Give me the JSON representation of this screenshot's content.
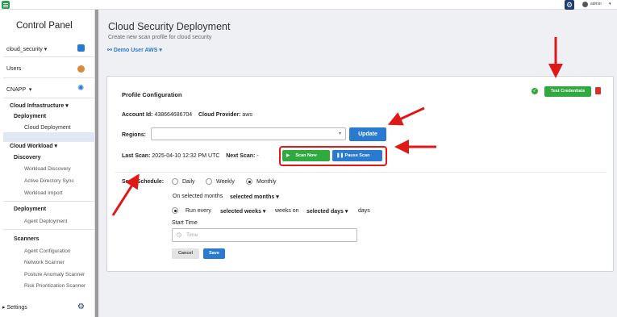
{
  "sidebar": {
    "title": "Control Panel",
    "tenant": "cloud_security",
    "users": "Users",
    "cnapp": "CNAPP",
    "cloud_infra": "Cloud Infrastructure",
    "deployment1": "Deployment",
    "cloud_deployment": "Cloud Deployment",
    "cloud_workload": "Cloud Workload",
    "discovery": "Discovery",
    "workload_discovery": "Workload Discovery",
    "ad_sync": "Active Directory Sync",
    "workload_import": "Workload Import",
    "deployment2": "Deployment",
    "agent_deployment": "Agent Deployment",
    "scanners": "Scanners",
    "agent_config": "Agent Configuration",
    "network_scanner": "Network Scanner",
    "posture_scanner": "Posture Anomaly Scanner",
    "risk_scanner": "Risk Prioritization Scanner",
    "settings": "Settings"
  },
  "header": {
    "title": "Cloud Security Deployment",
    "subtitle": "Create new scan profile for cloud security",
    "account_select": "Demo User AWS",
    "user_name": "admin"
  },
  "profile": {
    "section_title": "Profile Configuration",
    "test_credentials": "Test Credentials",
    "account_id_label": "Account Id:",
    "account_id": "438664686704",
    "provider_label": "Cloud Provider:",
    "provider": "aws",
    "regions_label": "Regions:",
    "regions_value": "",
    "update": "Update",
    "last_scan_label": "Last Scan:",
    "last_scan": "2025-04-10 12:32 PM UTC",
    "next_scan_label": "Next Scan:",
    "next_scan": "-",
    "scan_now": "Scan Now",
    "pause_scan": "Pause Scan"
  },
  "schedule": {
    "label": "Scan Schedule:",
    "daily": "Daily",
    "weekly": "Weekly",
    "monthly": "Monthly",
    "on_selected_months": "On selected months",
    "selected_months": "selected months",
    "run_every": "Run every",
    "selected_weeks": "selected weeks",
    "weeks_on": "weeks on",
    "selected_days": "selected days",
    "days": "days",
    "start_time_label": "Start Time",
    "time_placeholder": "Time",
    "cancel": "Cancel",
    "save": "Save"
  },
  "colors": {
    "green": "#2faa3f",
    "blue": "#2a7bcf",
    "arrow_red": "#e01818",
    "delete_red": "#d9302c"
  }
}
